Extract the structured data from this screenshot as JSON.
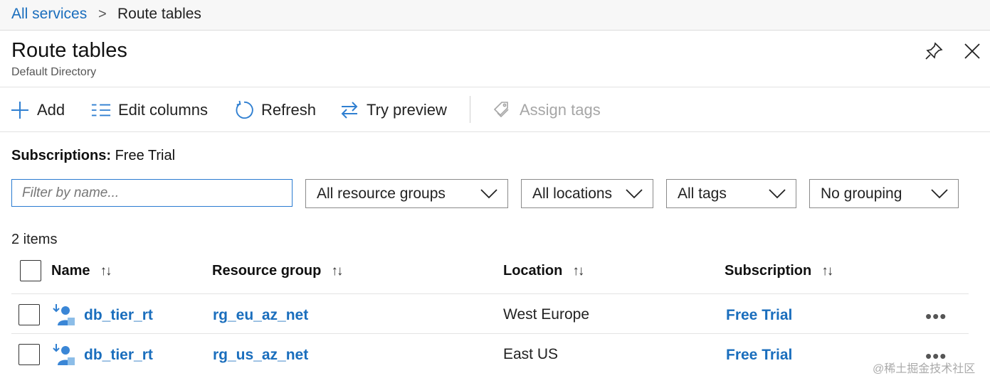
{
  "breadcrumb": {
    "root": "All services",
    "separator": ">",
    "current": "Route tables"
  },
  "header": {
    "title": "Route tables",
    "subtitle": "Default Directory"
  },
  "toolbar": {
    "add": "Add",
    "edit_columns": "Edit columns",
    "refresh": "Refresh",
    "try_preview": "Try preview",
    "assign_tags": "Assign tags"
  },
  "subscriptions": {
    "label": "Subscriptions:",
    "value": "Free Trial"
  },
  "filters": {
    "name_placeholder": "Filter by name...",
    "resource_groups": "All resource groups",
    "locations": "All locations",
    "tags": "All tags",
    "grouping": "No grouping"
  },
  "list": {
    "count": "2 items",
    "columns": [
      "Name",
      "Resource group",
      "Location",
      "Subscription"
    ],
    "sort_glyph": "↑↓",
    "more_glyph": "•••",
    "rows": [
      {
        "name": "db_tier_rt",
        "resource_group": "rg_eu_az_net",
        "location": "West Europe",
        "subscription": "Free Trial"
      },
      {
        "name": "db_tier_rt",
        "resource_group": "rg_us_az_net",
        "location": "East US",
        "subscription": "Free Trial"
      }
    ]
  },
  "watermark": "@稀土掘金技术社区",
  "colors": {
    "accent": "#1a6ebd",
    "icon_blue": "#2f7fd1",
    "disabled": "#a6a6a6"
  },
  "icons": {
    "breadcrumb": "chevron-right-icon",
    "pin": "pin-icon",
    "close": "close-icon",
    "add": "plus-icon",
    "edit_columns": "columns-icon",
    "refresh": "refresh-icon",
    "try_preview": "swap-arrows-icon",
    "assign_tags": "tag-icon",
    "dropdown": "chevron-down-icon",
    "route_table": "route-table-icon",
    "more": "more-icon"
  }
}
